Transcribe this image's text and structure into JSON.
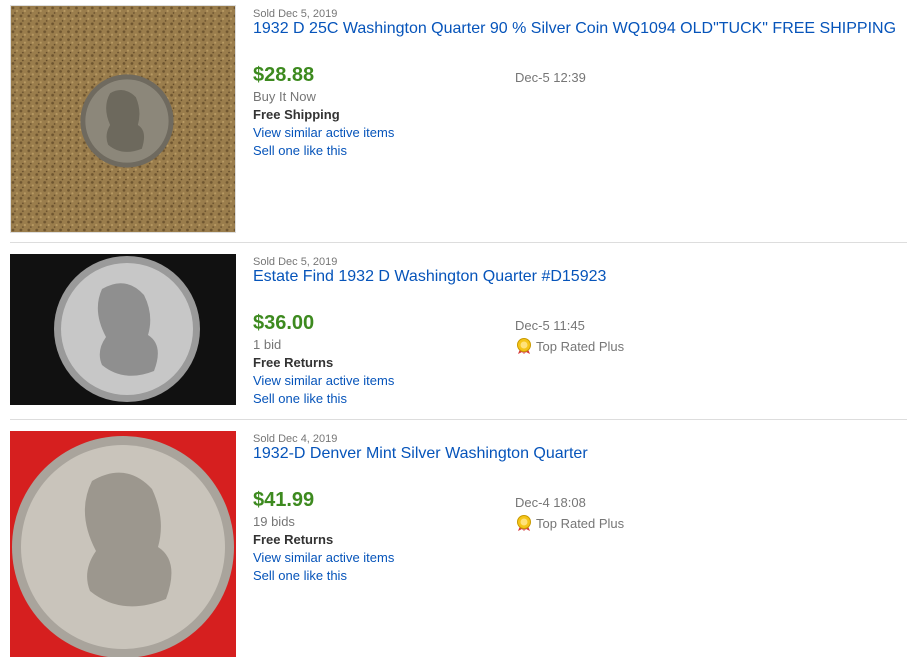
{
  "listings": [
    {
      "sold_date": "Sold Dec 5, 2019",
      "title": "1932 D 25C Washington Quarter 90 % Silver Coin WQ1094 OLD\"TUCK\" FREE SHIPPING",
      "price": "$28.88",
      "format": "Buy It Now",
      "shipping": "Free Shipping",
      "view_similar": "View similar active items",
      "sell_one": "Sell one like this",
      "end_time": "Dec-5 12:39",
      "top_rated": ""
    },
    {
      "sold_date": "Sold Dec 5, 2019",
      "title": "Estate Find 1932 D Washington Quarter #D15923",
      "price": "$36.00",
      "format": "1 bid",
      "shipping": "Free Returns",
      "view_similar": "View similar active items",
      "sell_one": "Sell one like this",
      "end_time": "Dec-5 11:45",
      "top_rated": "Top Rated Plus"
    },
    {
      "sold_date": "Sold Dec 4, 2019",
      "title": "1932-D Denver Mint Silver Washington Quarter",
      "price": "$41.99",
      "format": "19 bids",
      "shipping": "Free Returns",
      "view_similar": "View similar active items",
      "sell_one": "Sell one like this",
      "end_time": "Dec-4 18:08",
      "top_rated": "Top Rated Plus"
    }
  ]
}
